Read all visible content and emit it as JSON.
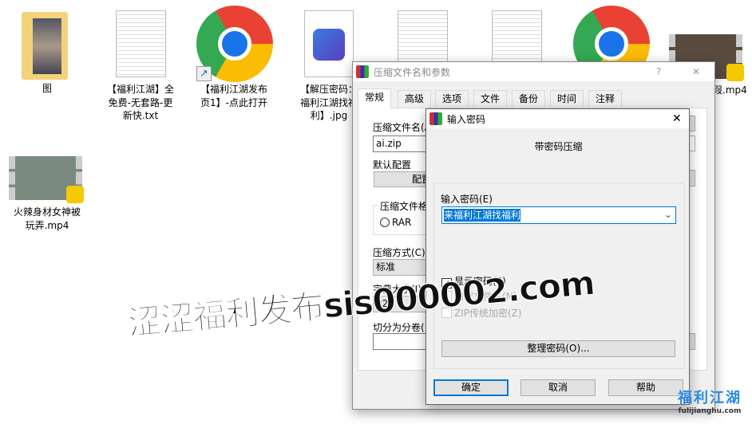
{
  "desktop": {
    "icons": [
      {
        "label": "图",
        "type": "folder"
      },
      {
        "label_lines": [
          "【福利江湖】全",
          "免费-无套路-更",
          "新快.txt"
        ],
        "type": "text-file"
      },
      {
        "label_lines": [
          "【福利江湖发布",
          "页1】-点此打开"
        ],
        "type": "chrome-shortcut"
      },
      {
        "label_lines": [
          "【解压密码：",
          "福利江湖找福",
          "利】.jpg"
        ],
        "type": "image-file"
      },
      {
        "type": "text-file"
      },
      {
        "type": "text-file"
      },
      {
        "type": "chrome"
      },
      {
        "label": "叚.mp4",
        "type": "video"
      },
      {
        "label_lines": [
          "火辣身材女神被",
          "玩弄.mp4"
        ],
        "type": "video"
      }
    ]
  },
  "main_dialog": {
    "title": "压缩文件名和参数",
    "help": "?",
    "close": "✕",
    "tabs": [
      "常规",
      "高级",
      "选项",
      "文件",
      "备份",
      "时间",
      "注释"
    ],
    "archive_name_label": "压缩文件名(A",
    "archive_name_value": "ai.zip",
    "default_profile_label": "默认配置",
    "profile_button": "配置",
    "format_group": "压缩文件格",
    "format_rar": "RAR",
    "method_label": "压缩方式(C)",
    "method_value": "标准",
    "dict_label": "字典大小(I)",
    "dict_value": "32",
    "split_label": "切分为分卷("
  },
  "password_dialog": {
    "title": "输入密码",
    "close": "✕",
    "heading": "带密码压缩",
    "password_label": "输入密码(E)",
    "password_value": "来福利江湖找福利",
    "show_password": "显示密码(S)",
    "show_password_checked": true,
    "encrypt_names": "加密文件名(N)",
    "zip_legacy": "ZIP传统加密(Z)",
    "organize_button": "整理密码(O)...",
    "ok": "确定",
    "cancel": "取消",
    "help": "帮助"
  },
  "watermark": {
    "text": "涩涩福利发布sis000002.com",
    "logo": "福利江湖",
    "logo_url": "fulijianghu.com"
  },
  "colors": {
    "accent": "#0078d7",
    "selection": "#0078d7"
  }
}
